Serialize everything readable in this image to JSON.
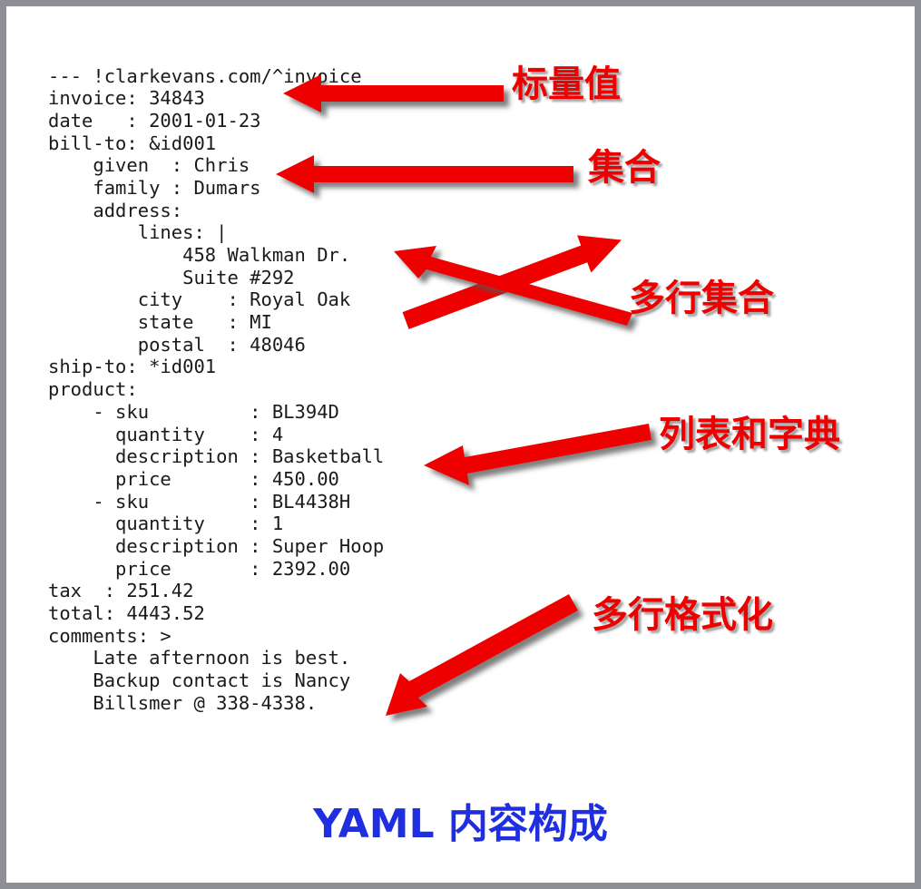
{
  "slide": {
    "background_color": "#ffffff",
    "border_color": "#8e8e96",
    "accent_red": "#ee0000",
    "accent_blue": "#1f2fe0",
    "code_color": "#1a1a1a"
  },
  "code": {
    "language": "yaml",
    "lines": [
      "--- !clarkevans.com/^invoice",
      "invoice: 34843",
      "date   : 2001-01-23",
      "bill-to: &id001",
      "    given  : Chris",
      "    family : Dumars",
      "    address:",
      "        lines: |",
      "            458 Walkman Dr.",
      "            Suite #292",
      "        city    : Royal Oak",
      "        state   : MI",
      "        postal  : 48046",
      "ship-to: *id001",
      "product:",
      "    - sku         : BL394D",
      "      quantity    : 4",
      "      description : Basketball",
      "      price       : 450.00",
      "    - sku         : BL4438H",
      "      quantity    : 1",
      "      description : Super Hoop",
      "      price       : 2392.00",
      "tax  : 251.42",
      "total: 4443.52",
      "comments: >",
      "    Late afternoon is best.",
      "    Backup contact is Nancy",
      "    Billsmer @ 338-4338."
    ]
  },
  "annotations": [
    {
      "id": "scalar-value",
      "label": "标量值"
    },
    {
      "id": "collection",
      "label": "集合"
    },
    {
      "id": "multiline-collection",
      "label": "多行集合"
    },
    {
      "id": "list-and-dict",
      "label": "列表和字典"
    },
    {
      "id": "multiline-format",
      "label": "多行格式化"
    }
  ],
  "bottom_title": {
    "text": "YAML 内容构成"
  }
}
